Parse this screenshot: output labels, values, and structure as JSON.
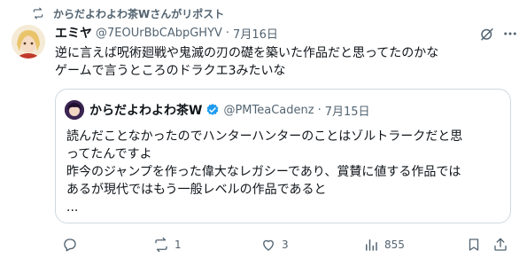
{
  "repost_banner": {
    "text": "からだよわよわ茶Wさんがリポスト"
  },
  "post": {
    "author_name": "エミヤ",
    "author_handle": "@7EOUrBbCAbpGHYV",
    "separator": "·",
    "time": "7月16日",
    "text_lines": [
      "逆に言えば呪術廻戦や鬼滅の刃の礎を築いた作品だと思ってたのかな",
      "ゲームで言うところのドラクエ3みたいな"
    ]
  },
  "quote": {
    "author_name": "からだよわよわ茶W",
    "author_handle": "@PMTeaCadenz",
    "separator": "·",
    "time": "7月15日",
    "text_lines": [
      "読んだことなかったのでハンターハンターのことはゾルトラークだと思",
      "ってたんですよ",
      "昨今のジャンプを作った偉大なレガシーであり、賞賛に値する作品では",
      "あるが現代ではもう一般レベルの作品であると",
      "..."
    ]
  },
  "actions": {
    "reply_count": "",
    "repost_count": "1",
    "like_count": "3",
    "view_count": "855"
  },
  "colors": {
    "text": "#0f1419",
    "muted": "#536471",
    "border": "#cfd9de",
    "verified": "#1d9bf0"
  }
}
